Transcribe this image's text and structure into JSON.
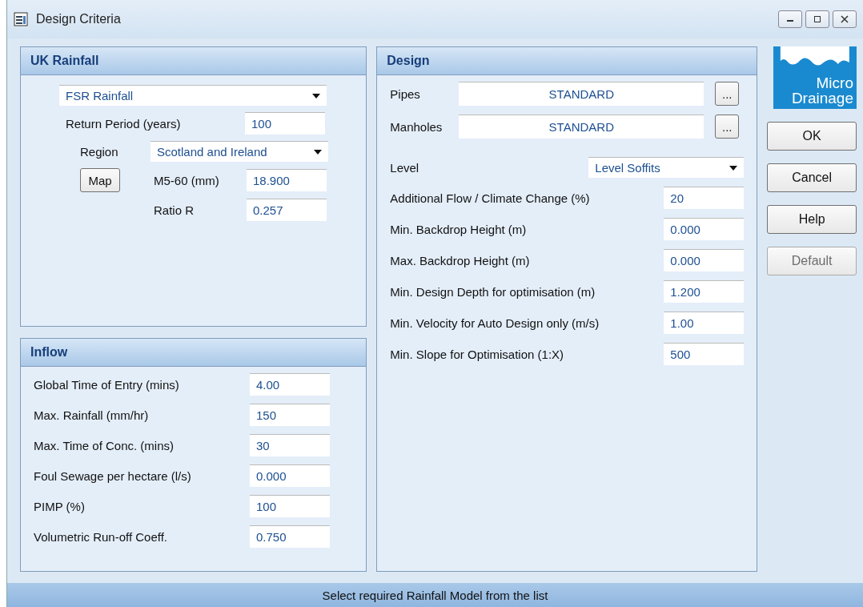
{
  "window": {
    "title": "Design Criteria"
  },
  "uk_rainfall": {
    "title": "UK Rainfall",
    "model": "FSR Rainfall",
    "return_period_label": "Return Period (years)",
    "return_period": "100",
    "region_label": "Region",
    "region": "Scotland and Ireland",
    "map_button": "Map",
    "m560_label": "M5-60 (mm)",
    "m560": "18.900",
    "ratio_label": "Ratio R",
    "ratio": "0.257"
  },
  "inflow": {
    "title": "Inflow",
    "fields": [
      {
        "label": "Global Time of Entry (mins)",
        "value": "4.00"
      },
      {
        "label": "Max. Rainfall (mm/hr)",
        "value": "150"
      },
      {
        "label": "Max. Time of Conc. (mins)",
        "value": "30"
      },
      {
        "label": "Foul Sewage per hectare (l/s)",
        "value": "0.000"
      },
      {
        "label": "PIMP (%)",
        "value": "100"
      },
      {
        "label": "Volumetric Run-off Coeff.",
        "value": "0.750"
      }
    ]
  },
  "design": {
    "title": "Design",
    "pipes_label": "Pipes",
    "pipes": "STANDARD",
    "manholes_label": "Manholes",
    "manholes": "STANDARD",
    "browse_button": "...",
    "level_label": "Level",
    "level": "Level Soffits",
    "fields": [
      {
        "label": "Additional Flow / Climate Change (%)",
        "value": "20"
      },
      {
        "label": "Min. Backdrop Height (m)",
        "value": "0.000"
      },
      {
        "label": "Max. Backdrop Height (m)",
        "value": "0.000"
      },
      {
        "label": "Min. Design Depth for optimisation (m)",
        "value": "1.200"
      },
      {
        "label": "Min. Velocity for Auto Design only (m/s)",
        "value": "1.00"
      },
      {
        "label": "Min. Slope for Optimisation (1:X)",
        "value": "500"
      }
    ]
  },
  "logo": {
    "line_1": "Micro",
    "line_2": "Drainage"
  },
  "buttons": [
    {
      "label": "OK",
      "disabled": false
    },
    {
      "label": "Cancel",
      "disabled": false
    },
    {
      "label": "Help",
      "disabled": false
    },
    {
      "label": "Default",
      "disabled": true
    }
  ],
  "status_bar": "Select required Rainfall Model from the list"
}
